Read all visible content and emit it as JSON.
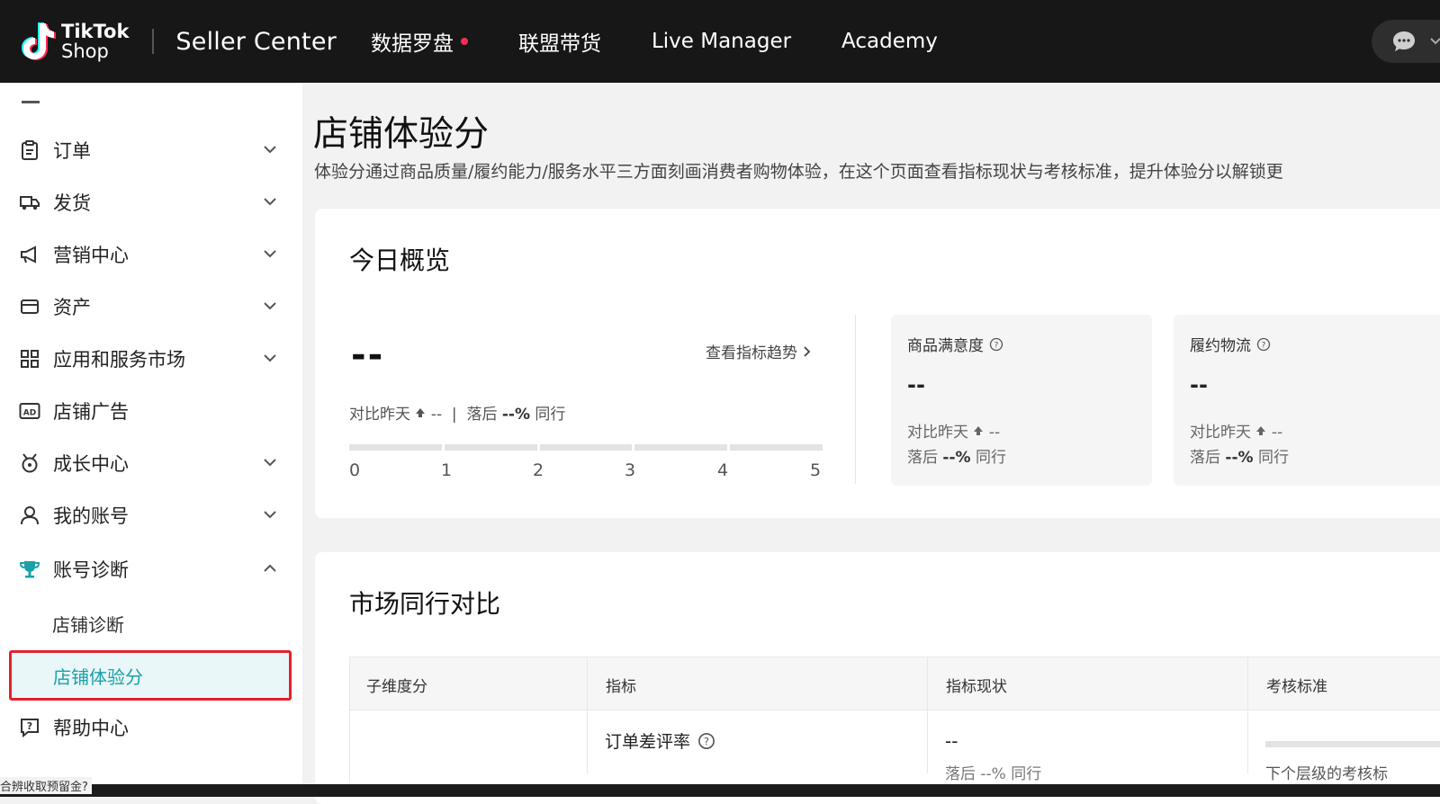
{
  "header": {
    "brand_line1": "TikTok",
    "brand_line2": "Shop",
    "title": "Seller Center",
    "nav": [
      {
        "label": "数据罗盘",
        "has_dot": true
      },
      {
        "label": "联盟带货"
      },
      {
        "label": "Live Manager"
      },
      {
        "label": "Academy"
      }
    ]
  },
  "sidebar": {
    "items": [
      {
        "label": "订单",
        "icon": "clipboard-icon",
        "expanded": false
      },
      {
        "label": "发货",
        "icon": "truck-icon",
        "expanded": false
      },
      {
        "label": "营销中心",
        "icon": "megaphone-icon",
        "expanded": false
      },
      {
        "label": "资产",
        "icon": "wallet-icon",
        "expanded": false
      },
      {
        "label": "应用和服务市场",
        "icon": "apps-grid-icon",
        "expanded": false
      },
      {
        "label": "店铺广告",
        "icon": "ad-icon"
      },
      {
        "label": "成长中心",
        "icon": "growth-icon",
        "expanded": false
      },
      {
        "label": "我的账号",
        "icon": "user-icon",
        "expanded": false
      },
      {
        "label": "账号诊断",
        "icon": "trophy-icon",
        "expanded": true
      },
      {
        "label": "帮助中心",
        "icon": "help-icon"
      }
    ],
    "sub_items": [
      "店铺诊断",
      "店铺体验分"
    ],
    "active": "店铺体验分"
  },
  "page": {
    "title": "店铺体验分",
    "description": "体验分通过商品质量/履约能力/服务水平三方面刻画消费者购物体验，在这个页面查看指标现状与考核标准，提升体验分以解锁更"
  },
  "overview": {
    "title": "今日概览",
    "score": "--",
    "trend_link": "查看指标趋势",
    "compare_prefix": "对比昨天",
    "compare_value": "--",
    "lag_prefix": "落后",
    "lag_value": "--%",
    "lag_suffix": "同行",
    "scale_ticks": [
      "0",
      "1",
      "2",
      "3",
      "4",
      "5"
    ],
    "metrics": [
      {
        "title": "商品满意度",
        "value": "--",
        "compare": "对比昨天",
        "compare_value": "--",
        "lag_prefix": "落后",
        "lag_value": "--%",
        "lag_suffix": "同行"
      },
      {
        "title": "履约物流",
        "value": "--",
        "compare": "对比昨天",
        "compare_value": "--",
        "lag_prefix": "落后",
        "lag_value": "--%",
        "lag_suffix": "同行"
      }
    ]
  },
  "market": {
    "title": "市场同行对比",
    "columns": [
      "子维度分",
      "指标",
      "指标现状",
      "考核标准"
    ],
    "rows": [
      {
        "metric": "订单差评率",
        "status": "--",
        "status_sub": "落后 --% 同行",
        "standard": "下个层级的考核标"
      }
    ]
  },
  "bottom_hint": "合辨收取预留金?",
  "colors": {
    "topbar": "#171717",
    "accent": "#1aa0a9",
    "highlight_border": "#e5212b",
    "dot": "#fe2c55"
  }
}
